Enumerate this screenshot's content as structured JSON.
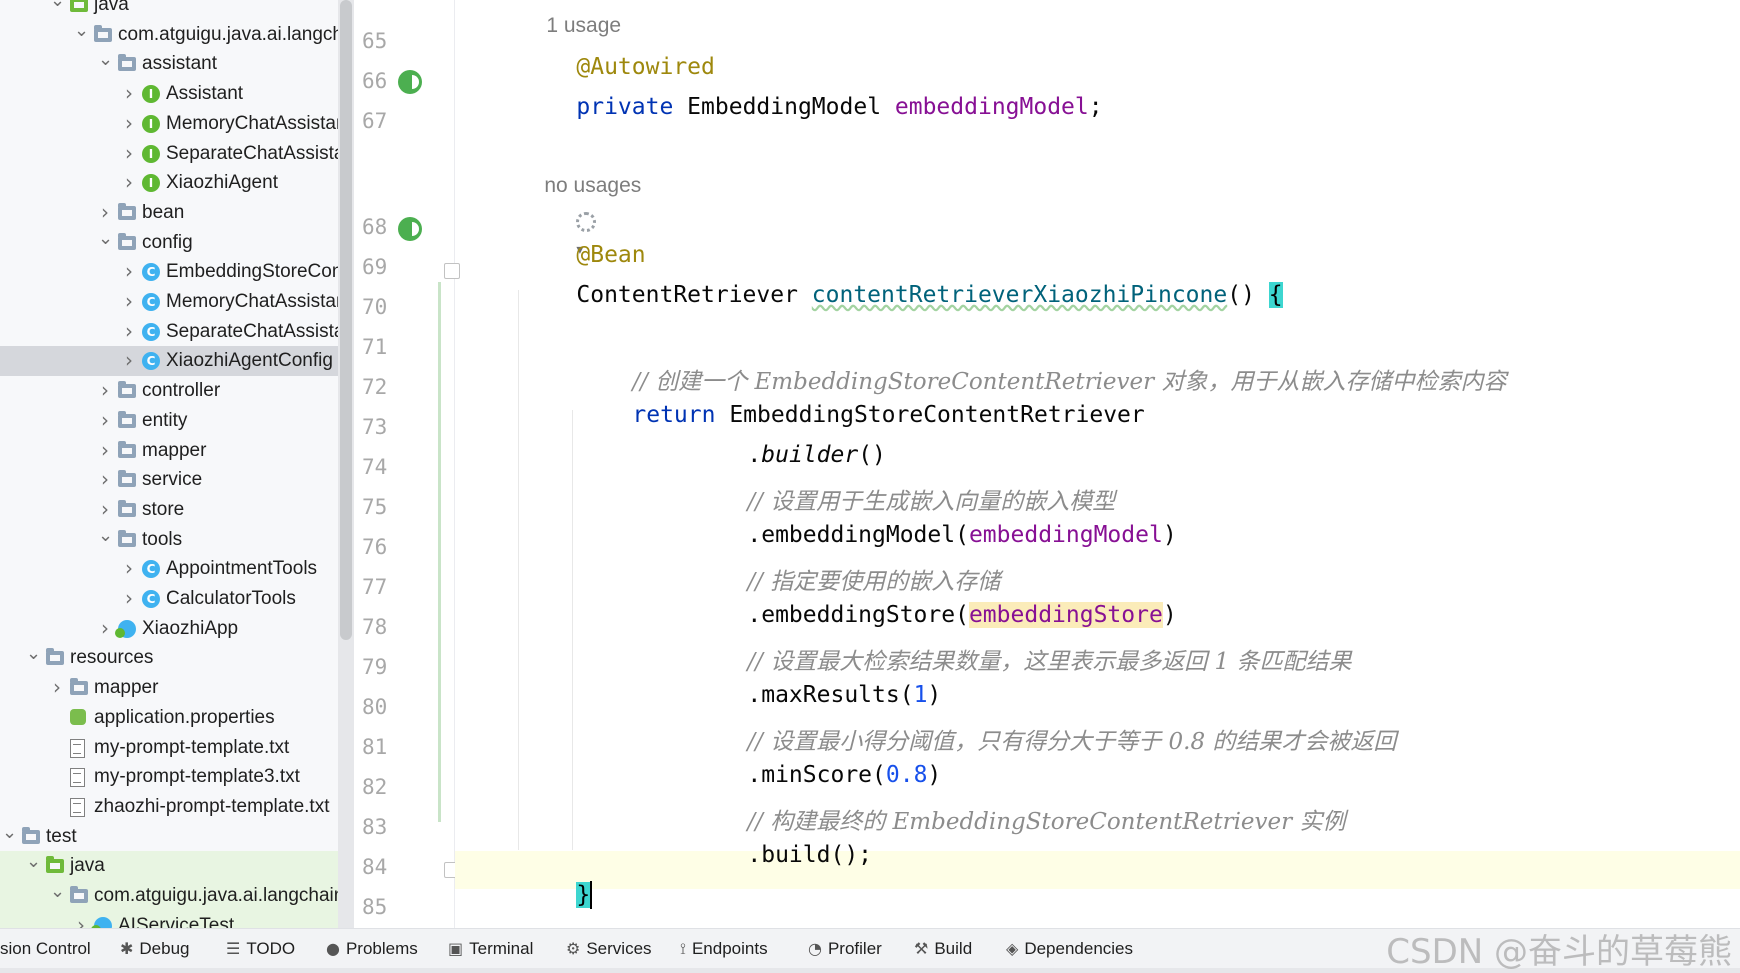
{
  "tree": {
    "items": [
      {
        "label": "java",
        "icon": "folder-icon",
        "expanded": true,
        "type": "gfolder"
      },
      {
        "label": "com.atguigu.java.ai.langchain",
        "icon": "package-folder-icon",
        "expanded": true,
        "type": "folder"
      },
      {
        "label": "assistant",
        "icon": "package-folder-icon",
        "expanded": true,
        "type": "folder"
      },
      {
        "label": "Assistant",
        "icon": "interface-icon",
        "expanded": false,
        "type": "interface"
      },
      {
        "label": "MemoryChatAssistant",
        "icon": "interface-icon",
        "expanded": false,
        "type": "interface"
      },
      {
        "label": "SeparateChatAssistant",
        "icon": "interface-icon",
        "expanded": false,
        "type": "interface"
      },
      {
        "label": "XiaozhiAgent",
        "icon": "interface-icon",
        "expanded": false,
        "type": "interface"
      },
      {
        "label": "bean",
        "icon": "package-folder-icon",
        "expanded": false,
        "type": "folder"
      },
      {
        "label": "config",
        "icon": "package-folder-icon",
        "expanded": true,
        "type": "folder"
      },
      {
        "label": "EmbeddingStoreConfig",
        "icon": "class-icon",
        "expanded": false,
        "type": "klass"
      },
      {
        "label": "MemoryChatAssistantConfig",
        "icon": "class-icon",
        "expanded": false,
        "type": "klass"
      },
      {
        "label": "SeparateChatAssistantConfig",
        "icon": "class-icon",
        "expanded": false,
        "type": "klass"
      },
      {
        "label": "XiaozhiAgentConfig",
        "icon": "class-icon",
        "expanded": false,
        "type": "klass",
        "selected": true
      },
      {
        "label": "controller",
        "icon": "package-folder-icon",
        "expanded": false,
        "type": "folder"
      },
      {
        "label": "entity",
        "icon": "package-folder-icon",
        "expanded": false,
        "type": "folder"
      },
      {
        "label": "mapper",
        "icon": "package-folder-icon",
        "expanded": false,
        "type": "folder"
      },
      {
        "label": "service",
        "icon": "package-folder-icon",
        "expanded": false,
        "type": "folder"
      },
      {
        "label": "store",
        "icon": "package-folder-icon",
        "expanded": false,
        "type": "folder"
      },
      {
        "label": "tools",
        "icon": "package-folder-icon",
        "expanded": true,
        "type": "folder"
      },
      {
        "label": "AppointmentTools",
        "icon": "class-icon",
        "expanded": false,
        "type": "klass"
      },
      {
        "label": "CalculatorTools",
        "icon": "class-icon",
        "expanded": false,
        "type": "klass"
      },
      {
        "label": "XiaozhiApp",
        "icon": "spring-app-class-icon",
        "expanded": false,
        "type": "appclass"
      },
      {
        "label": "resources",
        "icon": "resources-folder-icon",
        "expanded": true,
        "type": "rfolder"
      },
      {
        "label": "mapper",
        "icon": "folder-icon",
        "expanded": false,
        "type": "folder"
      },
      {
        "label": "application.properties",
        "icon": "properties-file-icon",
        "expanded": null,
        "type": "props"
      },
      {
        "label": "my-prompt-template.txt",
        "icon": "text-file-icon",
        "expanded": null,
        "type": "txt"
      },
      {
        "label": "my-prompt-template3.txt",
        "icon": "text-file-icon",
        "expanded": null,
        "type": "txt"
      },
      {
        "label": "zhaozhi-prompt-template.txt",
        "icon": "text-file-icon",
        "expanded": null,
        "type": "txt"
      },
      {
        "label": "test",
        "icon": "folder-icon",
        "expanded": true,
        "type": "folder"
      },
      {
        "label": "java",
        "icon": "test-folder-icon",
        "expanded": true,
        "type": "gfolder",
        "green": true
      },
      {
        "label": "com.atguigu.java.ai.langchain",
        "icon": "package-folder-icon",
        "expanded": true,
        "type": "folder",
        "green": true
      },
      {
        "label": "AIServiceTest",
        "icon": "test-class-icon",
        "expanded": false,
        "type": "appclass",
        "green": true
      }
    ]
  },
  "editor": {
    "usage_hint_top": "1 usage",
    "usage_hint_mid": "no usages",
    "line_numbers": [
      "65",
      "66",
      "67",
      "68",
      "69",
      "70",
      "71",
      "72",
      "73",
      "74",
      "75",
      "76",
      "77",
      "78",
      "79",
      "80",
      "81",
      "82",
      "83",
      "84",
      "85"
    ],
    "code": {
      "l65_annotation": "@Autowired",
      "l66_kw": "private",
      "l66_type": " EmbeddingModel ",
      "l66_field": "embeddingModel",
      "l66_end": ";",
      "l68_annotation": "@Bean",
      "l69_type": "ContentRetriever ",
      "l69_method": "contentRetrieverXiaozhiPincone",
      "l69_parens": "() ",
      "l69_brace": "{",
      "l71_comment": "// 创建一个 EmbeddingStoreContentRetriever 对象，用于从嵌入存储中检索内容",
      "l72_kw": "return",
      "l72_rest": " EmbeddingStoreContentRetriever",
      "l73_call": ".",
      "l73_method": "builder",
      "l73_end": "()",
      "l74_comment": "// 设置用于生成嵌入向量的嵌入模型",
      "l75_pre": ".embeddingModel(",
      "l75_arg": "embeddingModel",
      "l75_end": ")",
      "l76_comment": "// 指定要使用的嵌入存储",
      "l77_pre": ".embeddingStore(",
      "l77_arg": "embeddingStore",
      "l77_end": ")",
      "l78_comment": "// 设置最大检索结果数量，这里表示最多返回 1 条匹配结果",
      "l79_pre": ".maxResults(",
      "l79_arg": "1",
      "l79_end": ")",
      "l80_comment": "// 设置最小得分阈值，只有得分大于等于 0.8 的结果才会被返回",
      "l81_pre": ".minScore(",
      "l81_arg": "0.8",
      "l81_end": ")",
      "l82_comment": "// 构建最终的 EmbeddingStoreContentRetriever 实例",
      "l83_code": ".build();",
      "l84_brace": "}"
    }
  },
  "toolbar": {
    "items": [
      {
        "label": "sion Control",
        "icon": "version-control-icon"
      },
      {
        "label": "Debug",
        "icon": "bug-icon"
      },
      {
        "label": "TODO",
        "icon": "list-icon"
      },
      {
        "label": "Problems",
        "icon": "info-icon"
      },
      {
        "label": "Terminal",
        "icon": "terminal-icon"
      },
      {
        "label": "Services",
        "icon": "services-icon"
      },
      {
        "label": "Endpoints",
        "icon": "endpoints-icon"
      },
      {
        "label": "Profiler",
        "icon": "profiler-icon"
      },
      {
        "label": "Build",
        "icon": "hammer-icon"
      },
      {
        "label": "Dependencies",
        "icon": "layers-icon"
      }
    ]
  },
  "watermark": "CSDN @奋斗的草莓熊",
  "colors": {
    "keyword": "#0033b3",
    "annotation": "#9e880d",
    "field": "#871094",
    "method": "#00627a",
    "number": "#1750eb",
    "comment": "#8c8c8c",
    "selection": "#d5d7dc",
    "caret_line": "#fefee6"
  }
}
